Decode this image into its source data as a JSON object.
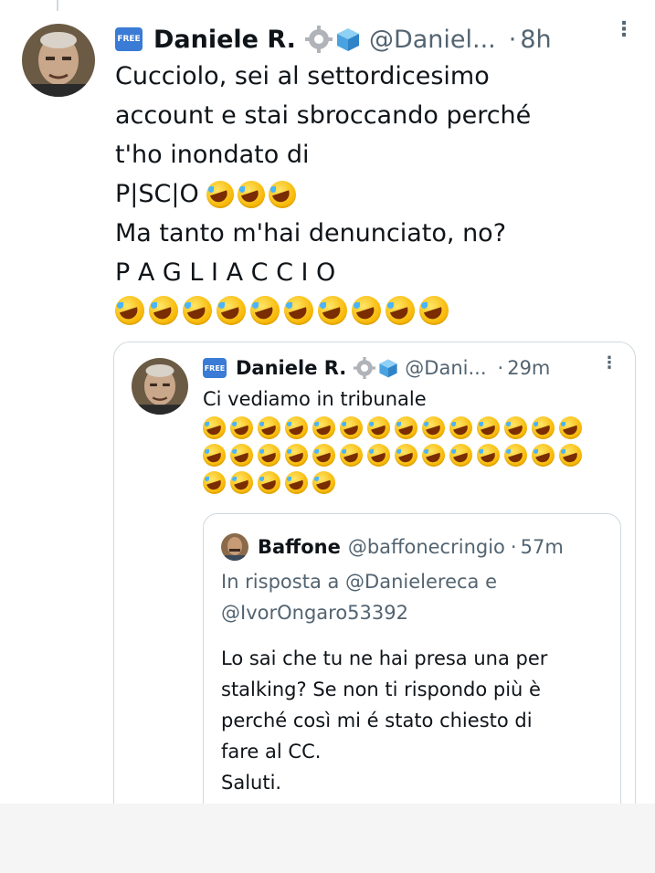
{
  "main_tweet": {
    "badge": "FREE",
    "name": "Daniele R.",
    "handle": "@Daniel...",
    "sep": "·",
    "time": "8h",
    "lines": [
      "Cucciolo, sei al settordicesimo",
      "account e stai sbroccando perché",
      "t'ho inondato di",
      "P|SC|O",
      "Ma tanto m'hai denunciato, no?",
      "P A G L I A C C I O"
    ],
    "emoji_after_pisc": 3,
    "emoji_final_row": 10
  },
  "quoted_tweet": {
    "badge": "FREE",
    "name": "Daniele R.",
    "handle": "@Dani...",
    "sep": "·",
    "time": "29m",
    "text": "Ci vediamo in tribunale",
    "emoji_rows": [
      14,
      14,
      5
    ]
  },
  "nested_quote": {
    "name": "Baffone",
    "handle": "@baffonecringio",
    "sep": "·",
    "time": "57m",
    "reply_prefix": "In risposta a",
    "reply_to_1": "@Danielereca",
    "reply_and": "e",
    "reply_to_2": "@IvorOngaro53392",
    "body": "Lo sai che tu ne hai presa una per\nstalking? Se non ti rispondo più è\nperché così mi é stato chiesto di\nfare al CC.\nSaluti."
  },
  "colors": {
    "text": "#0f1419",
    "muted": "#536471",
    "link": "#536471",
    "border": "#cfd9de",
    "badge": "#3a7bd5"
  }
}
